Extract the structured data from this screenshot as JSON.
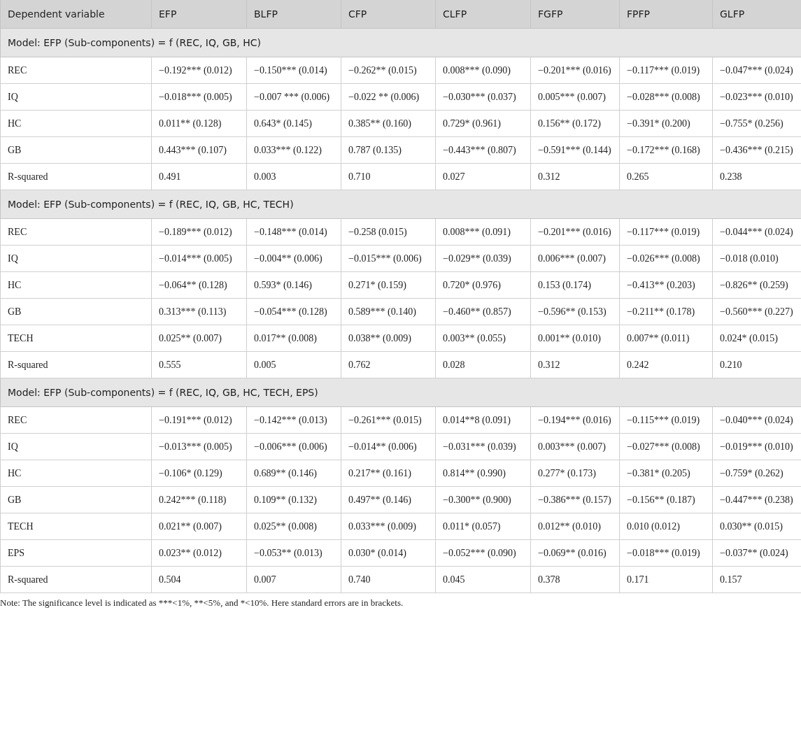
{
  "table": {
    "columns": [
      "Dependent variable",
      "EFP",
      "BLFP",
      "CFP",
      "CLFP",
      "FGFP",
      "FPFP",
      "GLFP"
    ],
    "sections": [
      {
        "title": "Model: EFP (Sub-components) = f (REC, IQ, GB, HC)",
        "rows": [
          {
            "label": "REC",
            "cells": [
              "−0.192*** (0.012)",
              "−0.150*** (0.014)",
              "−0.262** (0.015)",
              "0.008*** (0.090)",
              "−0.201*** (0.016)",
              "−0.117*** (0.019)",
              "−0.047*** (0.024)"
            ]
          },
          {
            "label": "IQ",
            "cells": [
              "−0.018*** (0.005)",
              "−0.007 *** (0.006)",
              "−0.022 ** (0.006)",
              "−0.030*** (0.037)",
              "0.005*** (0.007)",
              "−0.028*** (0.008)",
              "−0.023*** (0.010)"
            ]
          },
          {
            "label": "HC",
            "cells": [
              "0.011** (0.128)",
              "0.643* (0.145)",
              "0.385** (0.160)",
              "0.729* (0.961)",
              "0.156** (0.172)",
              "−0.391* (0.200)",
              "−0.755* (0.256)"
            ]
          },
          {
            "label": "GB",
            "cells": [
              "0.443*** (0.107)",
              "0.033*** (0.122)",
              "0.787 (0.135)",
              "−0.443*** (0.807)",
              "−0.591*** (0.144)",
              "−0.172*** (0.168)",
              "−0.436*** (0.215)"
            ]
          },
          {
            "label": "R-squared",
            "cells": [
              "0.491",
              "0.003",
              "0.710",
              "0.027",
              "0.312",
              "0.265",
              "0.238"
            ]
          }
        ]
      },
      {
        "title": "Model: EFP (Sub-components) = f (REC, IQ, GB, HC, TECH)",
        "rows": [
          {
            "label": "REC",
            "cells": [
              "−0.189*** (0.012)",
              "−0.148*** (0.014)",
              "−0.258 (0.015)",
              "0.008*** (0.091)",
              "−0.201*** (0.016)",
              "−0.117*** (0.019)",
              "−0.044*** (0.024)"
            ]
          },
          {
            "label": "IQ",
            "cells": [
              "−0.014*** (0.005)",
              "−0.004** (0.006)",
              "−0.015*** (0.006)",
              "−0.029** (0.039)",
              "0.006*** (0.007)",
              "−0.026*** (0.008)",
              "−0.018 (0.010)"
            ]
          },
          {
            "label": "HC",
            "cells": [
              "−0.064** (0.128)",
              "0.593* (0.146)",
              "0.271* (0.159)",
              "0.720* (0.976)",
              "0.153 (0.174)",
              "−0.413** (0.203)",
              "−0.826** (0.259)"
            ]
          },
          {
            "label": "GB",
            "cells": [
              "0.313*** (0.113)",
              "−0.054*** (0.128)",
              "0.589*** (0.140)",
              "−0.460** (0.857)",
              "−0.596** (0.153)",
              "−0.211** (0.178)",
              "−0.560*** (0.227)"
            ]
          },
          {
            "label": "TECH",
            "cells": [
              "0.025** (0.007)",
              "0.017** (0.008)",
              "0.038** (0.009)",
              "0.003** (0.055)",
              "0.001** (0.010)",
              "0.007** (0.011)",
              "0.024* (0.015)"
            ]
          },
          {
            "label": "R-squared",
            "cells": [
              "0.555",
              "0.005",
              "0.762",
              "0.028",
              "0.312",
              "0.242",
              "0.210"
            ]
          }
        ]
      },
      {
        "title": "Model: EFP (Sub-components) = f (REC, IQ, GB, HC, TECH, EPS)",
        "rows": [
          {
            "label": "REC",
            "cells": [
              "−0.191*** (0.012)",
              "−0.142*** (0.013)",
              "−0.261*** (0.015)",
              "0.014**8 (0.091)",
              "−0.194*** (0.016)",
              "−0.115*** (0.019)",
              "−0.040*** (0.024)"
            ]
          },
          {
            "label": "IQ",
            "cells": [
              "−0.013*** (0.005)",
              "−0.006*** (0.006)",
              "−0.014** (0.006)",
              "−0.031*** (0.039)",
              "0.003*** (0.007)",
              "−0.027*** (0.008)",
              "−0.019*** (0.010)"
            ]
          },
          {
            "label": "HC",
            "cells": [
              "−0.106* (0.129)",
              "0.689** (0.146)",
              "0.217** (0.161)",
              "0.814** (0.990)",
              "0.277* (0.173)",
              "−0.381* (0.205)",
              "−0.759* (0.262)"
            ]
          },
          {
            "label": "GB",
            "cells": [
              "0.242*** (0.118)",
              "0.109** (0.132)",
              "0.497** (0.146)",
              "−0.300** (0.900)",
              "−0.386*** (0.157)",
              "−0.156** (0.187)",
              "−0.447*** (0.238)"
            ]
          },
          {
            "label": "TECH",
            "cells": [
              "0.021** (0.007)",
              "0.025** (0.008)",
              "0.033*** (0.009)",
              "0.011* (0.057)",
              "0.012** (0.010)",
              "0.010 (0.012)",
              "0.030** (0.015)"
            ]
          },
          {
            "label": "EPS",
            "cells": [
              "0.023** (0.012)",
              "−0.053** (0.013)",
              "0.030* (0.014)",
              "−0.052*** (0.090)",
              "−0.069** (0.016)",
              "−0.018*** (0.019)",
              "−0.037** (0.024)"
            ]
          },
          {
            "label": "R-squared",
            "cells": [
              "0.504",
              "0.007",
              "0.740",
              "0.045",
              "0.378",
              "0.171",
              "0.157"
            ]
          }
        ]
      }
    ]
  },
  "note": "Note: The significance level is indicated as ***<1%, **<5%, and *<10%. Here standard errors are in brackets."
}
